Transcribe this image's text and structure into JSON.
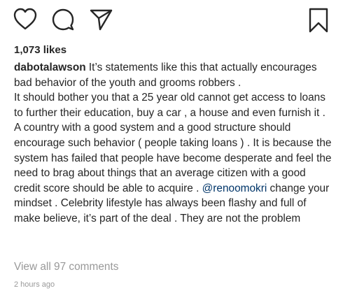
{
  "actions": {
    "like_icon": "heart-outline",
    "comment_icon": "speech-bubble-outline",
    "share_icon": "paper-plane-outline",
    "save_icon": "bookmark-outline",
    "icon_color": "#262626"
  },
  "post": {
    "likes": "1,073 likes",
    "caption": {
      "username": "dabotalawson",
      "line1": " It’s statements like this that actually encourages bad behavior of the youth and grooms robbers .",
      "paragraph2": "It should bother you that a 25 year old cannot get access to loans to further their education, buy a car , a house and even furnish it .",
      "paragraph3_before_mention": "A country with a good system and a good structure should encourage such behavior ( people taking loans ) . It is because the system has failed  that people have become desperate and feel the need to brag about things that an average citizen with a good credit score should be able to acquire . ",
      "mention": "@renoomokri",
      "paragraph3_after_mention": " change your mindset . Celebrity lifestyle has always been flashy and full of make believe, it’s part of the deal . They are not the problem"
    },
    "view_comments": "View all 97 comments",
    "timestamp": "2 hours ago",
    "colors": {
      "text": "#262626",
      "mention": "#003569",
      "muted": "#999999"
    }
  }
}
